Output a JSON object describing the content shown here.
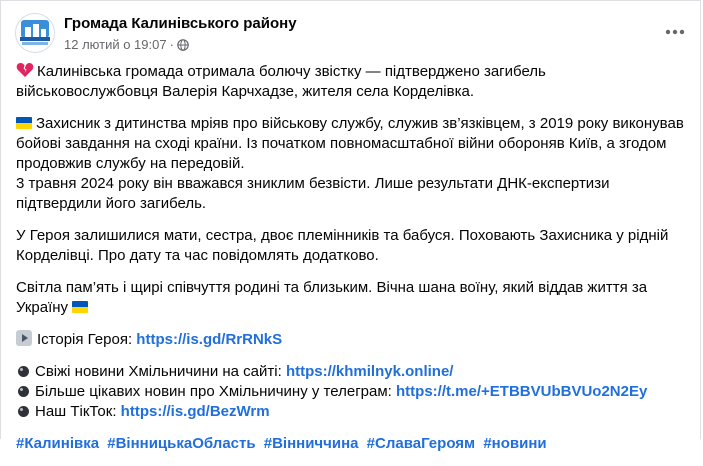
{
  "post": {
    "page_name": "Громада Калинівського району",
    "timestamp": "12 лютий о 19:07",
    "separator": "·",
    "audience_icon": "globe-icon",
    "more_icon": "more-horizontal-icon",
    "paragraphs": {
      "p1": "Калинівська громада отримала болючу звістку — підтверджено загибель військовослужбовця Валерія Карчхадзе, жителя села Корделівка.",
      "p2_line1": "Захисник з дитинства мріяв про військову службу, служив зв’язківцем, з 2019 року виконував бойові завдання на сході країни. Із початком повномасштабної війни обороняв Київ, а згодом продовжив службу на передовій.",
      "p2_line2": "3 травня 2024 року він вважався зниклим безвісти. Лише результати ДНК-експертизи підтвердили його загибель.",
      "p3": "У Героя залишилися мати, сестра, двоє племінників та бабуся. Поховають Захисника у рідній Корделівці. Про дату та час повідомлять додатково.",
      "p4": "Світла пам’ять і щирі співчуття родині та близьким. Вічна шана воїну, який віддав життя за Україну"
    },
    "story": {
      "label": "Історія Героя:",
      "url": "https://is.gd/RrRNkS"
    },
    "links": [
      {
        "label": "Свіжі новини Хмільничини на сайті:",
        "url": "https://khmilnyk.online/"
      },
      {
        "label": "Більше цікавих новин про Хмільничину у телеграм:",
        "url": "https://t.me/+ETBBVUbBVUo2N2Ey"
      },
      {
        "label": "Наш ТікТок:",
        "url": "https://is.gd/BezWrm"
      }
    ],
    "hashtags": [
      "#Калинівка",
      "#ВінницькаОбласть",
      "#Вінниччина",
      "#СлаваГероям",
      "#новини"
    ],
    "colors": {
      "link": "#216fdb",
      "meta": "#65676b",
      "text": "#050505",
      "flag_blue": "#0057b7",
      "flag_yellow": "#ffd700",
      "heart": "#e0245e"
    }
  }
}
